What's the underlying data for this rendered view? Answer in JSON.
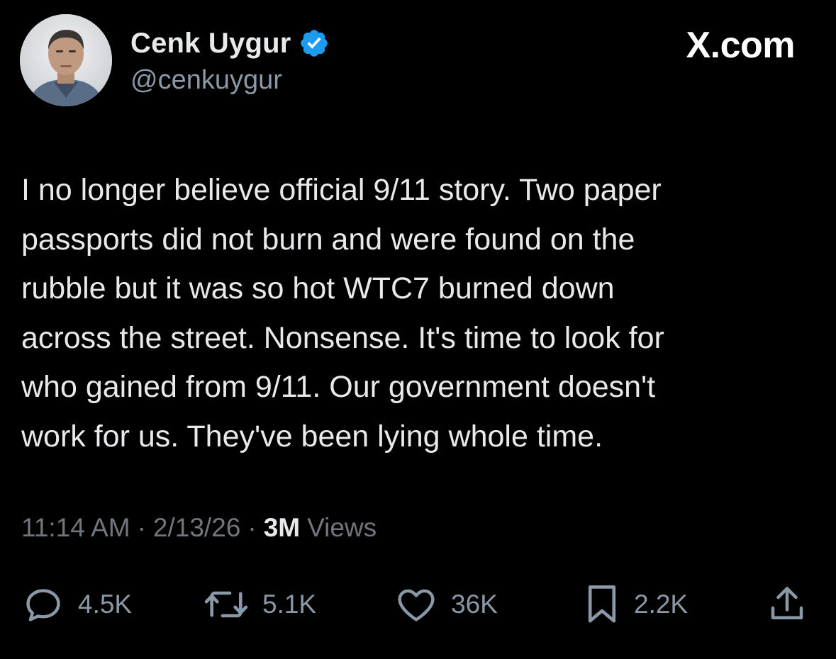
{
  "header": {
    "display_name": "Cenk Uygur",
    "handle": "@cenkuygur",
    "brand": "X.com"
  },
  "tweet": {
    "text": "I no longer believe official 9/11 story. Two paper\npassports did not burn and were found on the\nrubble but it was so hot WTC7 burned down\nacross the street. Nonsense. It's time to look for\nwho gained from 9/11. Our government doesn't\nwork for us. They've been lying whole time."
  },
  "meta": {
    "time": "11:14 AM",
    "separator": "·",
    "date": "2/13/26",
    "views_count": "3M",
    "views_label": "Views"
  },
  "actions": {
    "reply_count": "4.5K",
    "retweet_count": "5.1K",
    "like_count": "36K",
    "bookmark_count": "2.2K"
  },
  "colors": {
    "background": "#000000",
    "text_primary": "#e7e9ea",
    "text_secondary": "#71767b",
    "verified_badge": "#1d9bf0"
  },
  "icons": {
    "verified": "verified-badge-icon",
    "reply": "speech-bubble-icon",
    "retweet": "retweet-arrows-icon",
    "like": "heart-icon",
    "bookmark": "bookmark-icon",
    "share": "share-upload-icon"
  }
}
